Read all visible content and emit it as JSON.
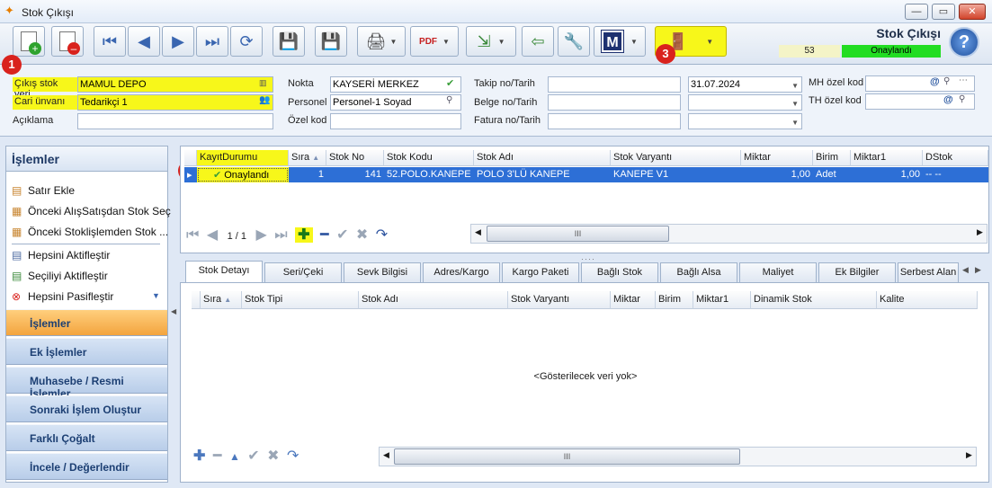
{
  "window": {
    "title": "Stok Çıkışı",
    "min": "—",
    "max": "▭",
    "close": "✕"
  },
  "toolbar": {
    "new_icon": "new-document-icon",
    "delete_icon": "delete-document-icon",
    "nav_first": "⏮",
    "nav_prev": "◀",
    "nav_next": "▶",
    "nav_last": "⏭",
    "refresh": "⟳",
    "save": "💾",
    "save_close": "💾",
    "print": "🖨",
    "pdf": "PDF",
    "export": "⇲",
    "back": "⇦",
    "tools": "🔧",
    "m_label": "M",
    "exit": "🚪",
    "header_title": "Stok Çıkışı",
    "status_number": "53",
    "status_label": "Onaylandı",
    "help": "?"
  },
  "badges": [
    "1",
    "2",
    "3"
  ],
  "form": {
    "cikis_stok_yeri_label": "Çıkış stok yeri",
    "cikis_stok_yeri": "MAMUL DEPO",
    "cari_unvani_label": "Cari ünvanı",
    "cari_unvani": "Tedarikçi 1",
    "aciklama_label": "Açıklama",
    "aciklama": "",
    "nokta_label": "Nokta",
    "nokta": "KAYSERİ MERKEZ",
    "personel_label": "Personel",
    "personel": "Personel-1 Soyad",
    "ozel_kod_label": "Özel kod",
    "ozel_kod": "",
    "takip_label": "Takip no/Tarih",
    "takip_no": "",
    "takip_tarih": "31.07.2024",
    "belge_label": "Belge no/Tarih",
    "belge_no": "",
    "belge_tarih": "",
    "fatura_label": "Fatura no/Tarih",
    "fatura_no": "",
    "fatura_tarih": "",
    "mh_label": "MH özel kod",
    "mh_value": "",
    "th_label": "TH özel kod",
    "th_value": ""
  },
  "sidebar": {
    "header": "İşlemler",
    "items": [
      {
        "label": "Satır Ekle"
      },
      {
        "label": "Önceki AlışSatışdan Stok Seç"
      },
      {
        "label": "Önceki Stoklişlemden Stok ..."
      },
      {
        "label": "Hepsini Aktifleştir"
      },
      {
        "label": "Seçiliyi Aktifleştir"
      },
      {
        "label": "Hepsini Pasifleştir"
      }
    ],
    "nav": [
      {
        "label": "İşlemler"
      },
      {
        "label": "Ek İşlemler"
      },
      {
        "label": "Muhasebe / Resmi İşlemler"
      },
      {
        "label": "Sonraki İşlem Oluştur"
      },
      {
        "label": "Farklı Çoğalt"
      },
      {
        "label": "İncele / Değerlendir"
      }
    ]
  },
  "grid": {
    "columns": [
      "KayıtDurumu",
      "Sıra",
      "Stok No",
      "Stok Kodu",
      "Stok Adı",
      "Stok Varyantı",
      "Miktar",
      "Birim",
      "Miktar1",
      "DStok"
    ],
    "row": {
      "durum": "Onaylandı",
      "sira": "1",
      "stok_no": "141",
      "stok_kodu": "52.POLO.KANEPE",
      "stok_adi": "POLO 3'LÜ KANEPE",
      "varyant": "KANEPE V1",
      "miktar": "1,00",
      "birim": "Adet",
      "miktar1": "1,00",
      "dstok": "-- --"
    },
    "pager": "1 / 1",
    "scroll_mark": "III"
  },
  "tabs": [
    "Stok Detayı",
    "Seri/Çeki",
    "Sevk Bilgisi",
    "Adres/Kargo",
    "Kargo Paketi",
    "Bağlı Stok",
    "Bağlı Alsa",
    "Maliyet",
    "Ek Bilgiler",
    "Serbest Alan"
  ],
  "detail": {
    "columns": [
      "Sıra",
      "Stok Tipi",
      "Stok Adı",
      "Stok Varyantı",
      "Miktar",
      "Birim",
      "Miktar1",
      "Dinamik Stok",
      "Kalite"
    ],
    "empty_text": "<Gösterilecek veri yok>",
    "scroll_mark": "III"
  },
  "colors": {
    "highlight": "#f7f71a",
    "selected_row": "#2d6fd6",
    "active_nav": "#f3a43e",
    "status_green": "#22dd22",
    "badge_red": "#d9221d"
  }
}
